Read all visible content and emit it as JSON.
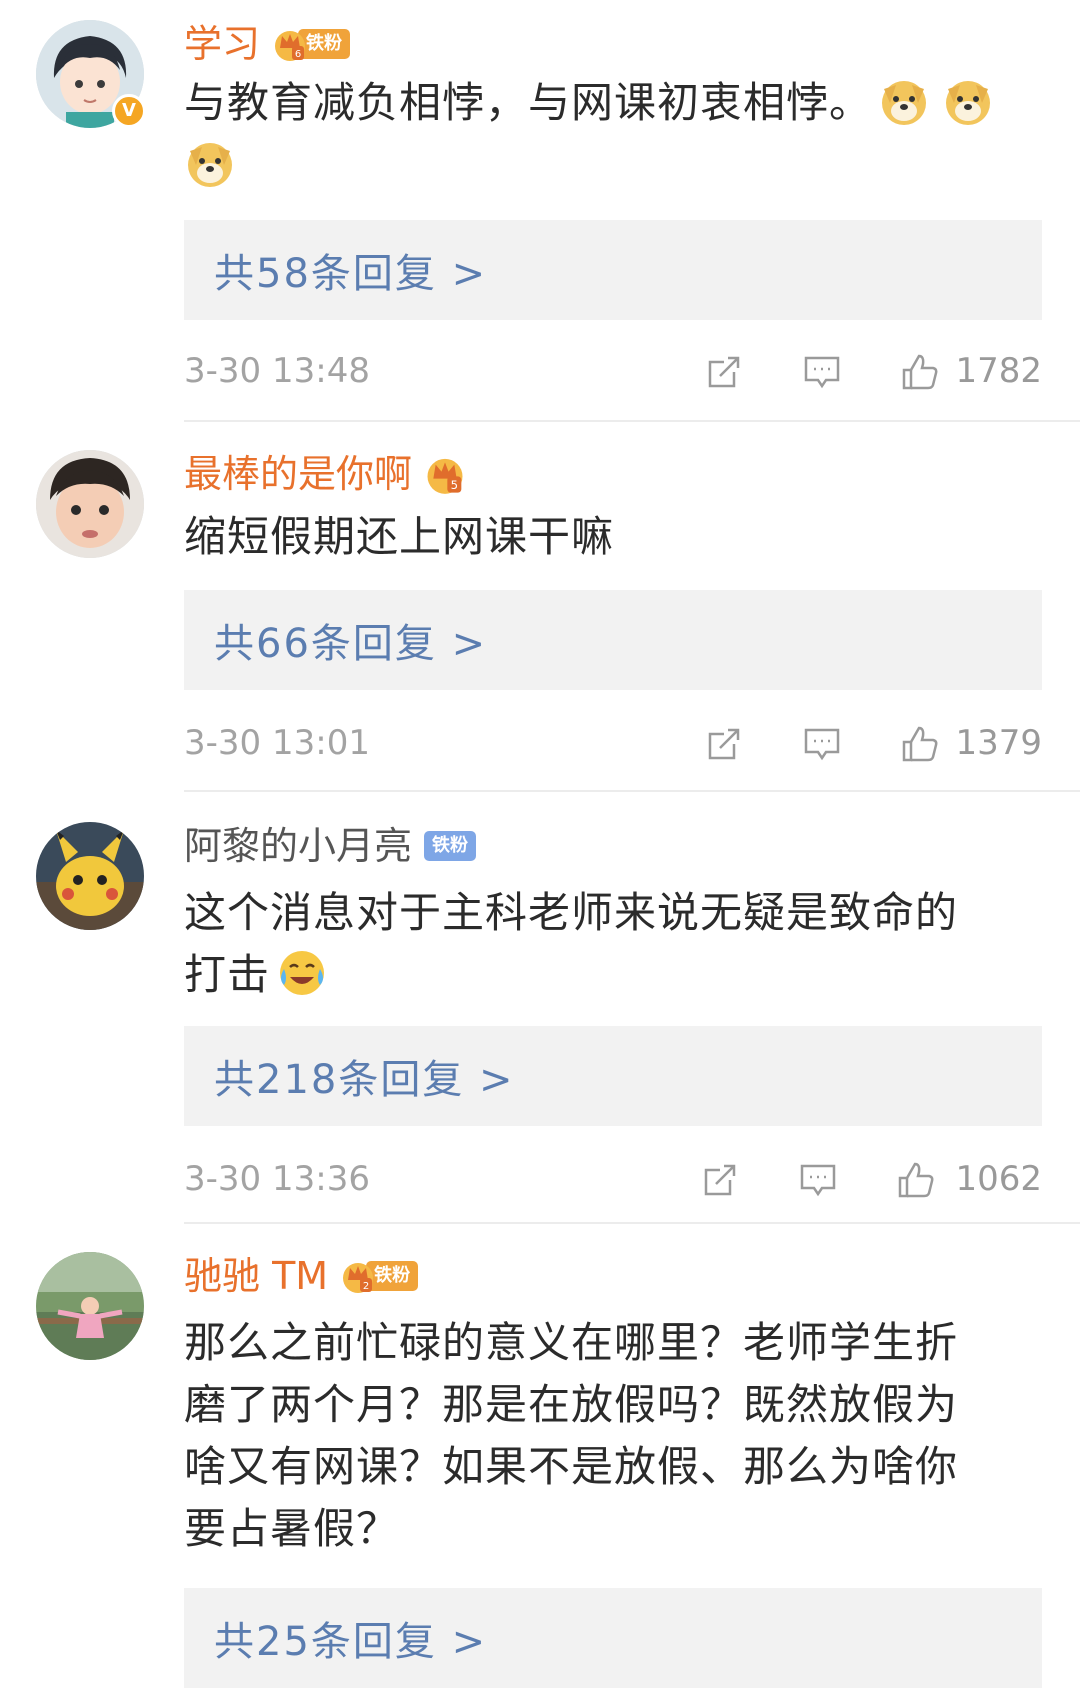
{
  "comments": [
    {
      "name": "学习",
      "name_color": "#e8712c",
      "verified": true,
      "crown_level": "6",
      "fans_badge": "铁粉",
      "text": "与教育减负相悖，与网课初衷相悖。",
      "trailing_emoji": [
        "doge-emoji",
        "doge-emoji",
        "doge-emoji"
      ],
      "reply_label": "共58条回复 >",
      "time": "3-30 13:48",
      "likes": "1782"
    },
    {
      "name": "最棒的是你啊",
      "name_color": "#e8712c",
      "verified": false,
      "crown_level": "5",
      "text": "缩短假期还上网课干嘛",
      "reply_label": "共66条回复 >",
      "time": "3-30 13:01",
      "likes": "1379"
    },
    {
      "name": "阿黎的小月亮",
      "name_color": "#555555",
      "verified": false,
      "fans_badge": "铁粉",
      "text": "这个消息对于主科老师来说无疑是致命的打击",
      "trailing_emoji": [
        "laugh-cry-emoji"
      ],
      "reply_label": "共218条回复 >",
      "time": "3-30 13:36",
      "likes": "1062"
    },
    {
      "name": "驰驰 TM",
      "name_color": "#e8712c",
      "verified": false,
      "crown_level": "2",
      "fans_badge": "铁粉",
      "text": "那么之前忙碌的意义在哪里？老师学生折磨了两个月？那是在放假吗？既然放假为啥又有网课？如果不是放假、那么为啥你要占暑假？",
      "reply_label": "共25条回复 >"
    }
  ],
  "icons": {
    "share": "share-icon",
    "comment": "comment-icon",
    "like": "like-icon"
  },
  "colors": {
    "name_orange": "#e8712c",
    "reply_blue": "#5b7db0",
    "reply_bg": "#f2f2f2",
    "meta_gray": "#a3a3a3"
  }
}
